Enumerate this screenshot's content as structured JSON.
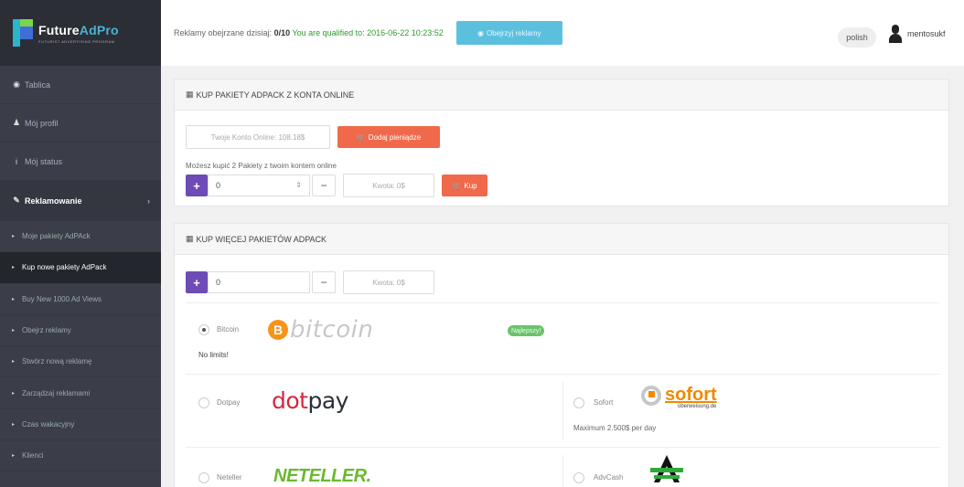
{
  "brand": {
    "name_a": "Future",
    "name_b": "AdPro",
    "tagline": "FUTURIST ADVERTISING PROGRAM"
  },
  "sidebar": {
    "items": [
      {
        "label": "Tablica",
        "icon": "dashboard-icon"
      },
      {
        "label": "Mój profil",
        "icon": "user-icon"
      },
      {
        "label": "Mój status",
        "icon": "info-icon"
      }
    ],
    "section": {
      "label": "Reklamowanie",
      "icon": "pencil-icon"
    },
    "subitems": [
      "Moje pakiety AdPAck",
      "Kup nowe pakiety AdPack",
      "Buy New 1000 Ad Views",
      "Obejrz reklamy",
      "Stwórz nową reklamę",
      "Zarządzaj reklamami",
      "Czas wakacyjny",
      "Klienci"
    ]
  },
  "topbar": {
    "ads_label": "Reklamy obejrzane dzisiaj:",
    "ads_count": "0/10",
    "qualified": "You are qualified to: 2016-06-22 10:23:52",
    "watch_button": "Obejrzyj reklamy",
    "language": "polish",
    "username": "mentosukf"
  },
  "panel1": {
    "title": "KUP PAKIETY ADPACK Z KONTA ONLINE",
    "balance": "Twoje Konto Online: 108.18$",
    "add_money_button": "Dodaj pieniądze",
    "note": "Możesz kupić 2 Pakiety z twoim kontem online",
    "quantity": "0",
    "amount": "Kwota: 0$",
    "buy_button": "Kup"
  },
  "panel2": {
    "title": "KUP WIĘCEJ PAKIETÓW ADPACK",
    "quantity": "0",
    "amount": "Kwota: 0$",
    "methods": {
      "bitcoin": {
        "label": "Bitcoin",
        "logo_symbol": "B",
        "logo_text": "bitcoin",
        "badge": "Najlepszy!",
        "note": "No limits!"
      },
      "dotpay": {
        "label": "Dotpay",
        "logo_a": "dot",
        "logo_b": "pay"
      },
      "sofort": {
        "label": "Sofort",
        "logo_text": "sofort",
        "logo_sub": "überweisung.de",
        "note": "Maximum 2.500$ per day"
      },
      "neteller": {
        "label": "Neteller",
        "logo_text": "NETELLER."
      },
      "advcash": {
        "label": "AdvCash"
      }
    }
  },
  "colors": {
    "sidebar": "#3b3e48",
    "accent_red": "#f0694a",
    "accent_purple": "#6e4bb6",
    "accent_blue": "#5bc0de",
    "qualified_green": "#2e9b2e"
  }
}
